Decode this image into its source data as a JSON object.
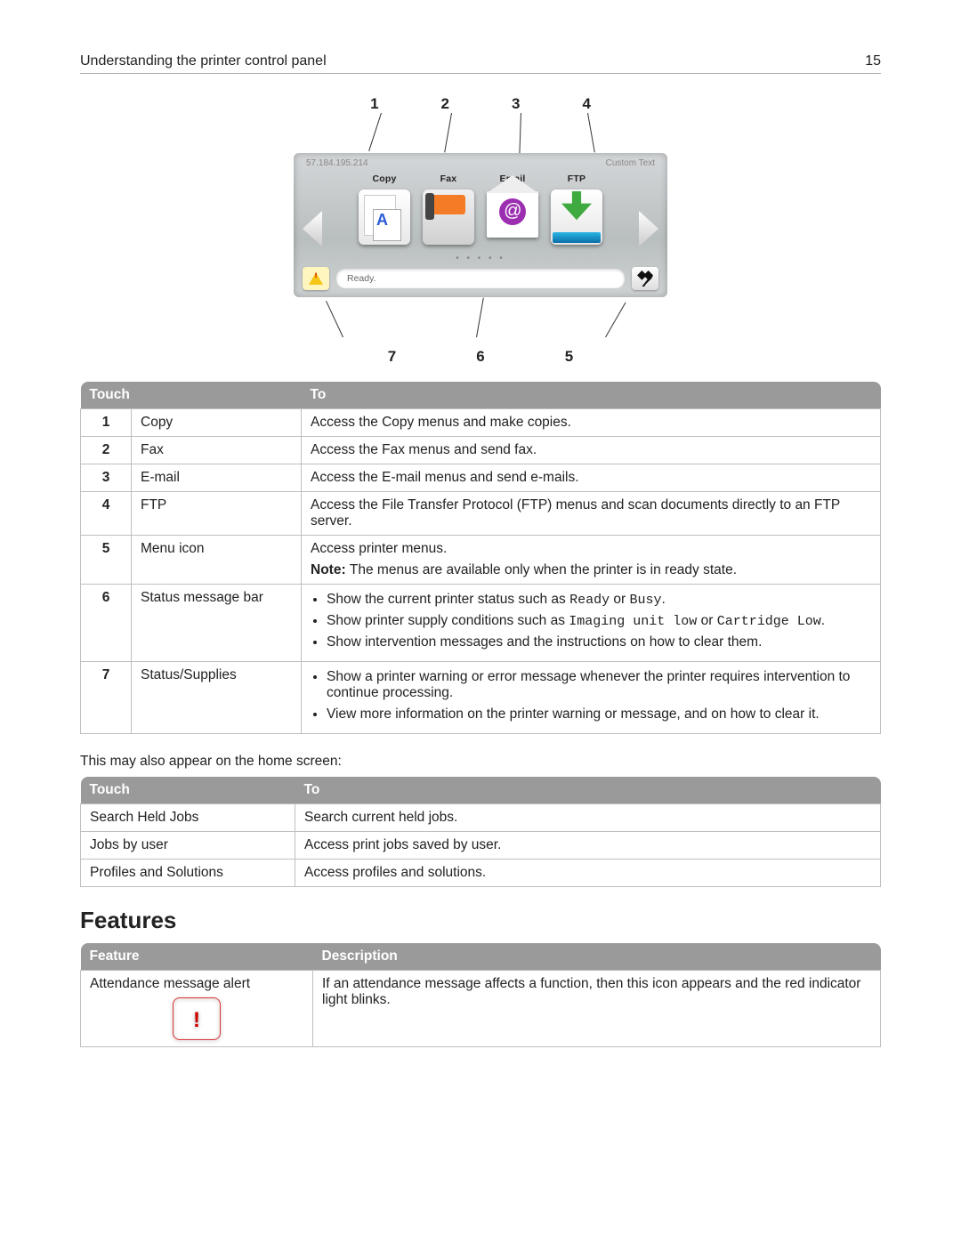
{
  "header": {
    "title": "Understanding the printer control panel",
    "page": "15"
  },
  "diagram": {
    "topNums": [
      "1",
      "2",
      "3",
      "4"
    ],
    "botNums": [
      "7",
      "6",
      "5"
    ],
    "ip": "57.184.195.214",
    "topRight": "Custom Text",
    "icons": {
      "copy": "Copy",
      "fax": "Fax",
      "email": "Email",
      "ftp": "FTP"
    },
    "status": "Ready."
  },
  "table1": {
    "h1": "Touch",
    "h2": "To",
    "rows": [
      {
        "n": "1",
        "name": "Copy",
        "desc": "Access the Copy menus and make copies."
      },
      {
        "n": "2",
        "name": "Fax",
        "desc": "Access the Fax menus and send fax."
      },
      {
        "n": "3",
        "name": "E-mail",
        "desc": "Access the E-mail menus and send e-mails."
      },
      {
        "n": "4",
        "name": "FTP",
        "desc": "Access the File Transfer Protocol (FTP) menus and scan documents directly to an FTP server."
      }
    ],
    "row5": {
      "n": "5",
      "name": "Menu icon",
      "l1": "Access printer menus.",
      "notePrefix": "Note: ",
      "note": "The menus are available only when the printer is in ready state."
    },
    "row6": {
      "n": "6",
      "name": "Status message bar",
      "b1a": "Show the current printer status such as ",
      "b1m1": "Ready",
      "b1b": " or ",
      "b1m2": "Busy",
      "b1c": ".",
      "b2a": "Show printer supply conditions such as ",
      "b2m1": "Imaging unit low",
      "b2b": " or ",
      "b2m2": "Cartridge Low",
      "b2c": ".",
      "b3": "Show intervention messages and the instructions on how to clear them."
    },
    "row7": {
      "n": "7",
      "name": "Status/Supplies",
      "b1": "Show a printer warning or error message whenever the printer requires intervention to continue processing.",
      "b2": "View more information on the printer warning or message, and on how to clear it."
    }
  },
  "midPara": "This may also appear on the home screen:",
  "table2": {
    "h1": "Touch",
    "h2": "To",
    "rows": [
      {
        "name": "Search Held Jobs",
        "desc": "Search current held jobs."
      },
      {
        "name": "Jobs by user",
        "desc": "Access print jobs saved by user."
      },
      {
        "name": "Profiles and Solutions",
        "desc": "Access profiles and solutions."
      }
    ]
  },
  "featuresHeading": "Features",
  "table3": {
    "h1": "Feature",
    "h2": "Description",
    "row": {
      "name": "Attendance message alert",
      "desc": "If an attendance message affects a function, then this icon appears and the red indicator light blinks."
    }
  }
}
